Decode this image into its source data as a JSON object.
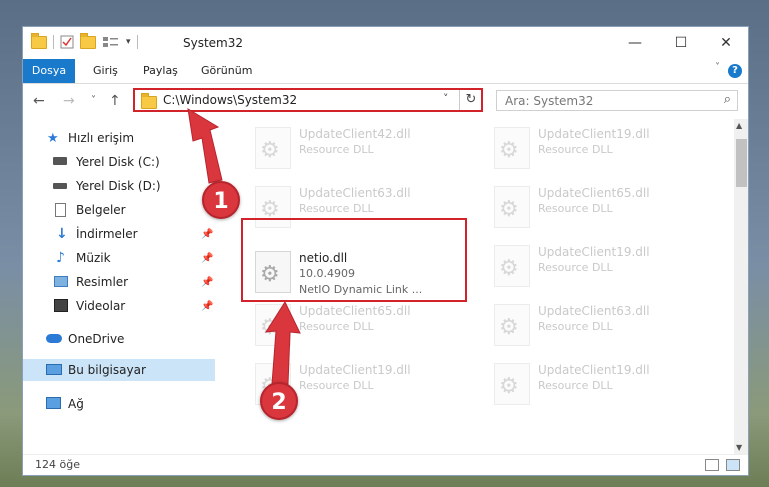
{
  "window": {
    "title": "System32",
    "minimize": "—",
    "maximize": "☐",
    "close": "✕"
  },
  "ribbon": {
    "tabs": [
      "Dosya",
      "Giriş",
      "Paylaş",
      "Görünüm"
    ],
    "help": "?"
  },
  "nav": {
    "back": "←",
    "forward": "→",
    "recent": "˅",
    "up": "↑"
  },
  "address": {
    "path": "C:\\Windows\\System32",
    "dropdown": "˅",
    "refresh": "↻"
  },
  "search": {
    "placeholder": "Ara: System32",
    "icon": "⌕"
  },
  "sidebar": {
    "items": [
      {
        "label": "Hızlı erişim",
        "icon": "star-icon"
      },
      {
        "label": "Yerel Disk (C:)",
        "icon": "drive-icon"
      },
      {
        "label": "Yerel Disk (D:)",
        "icon": "drive-icon"
      },
      {
        "label": "Belgeler",
        "icon": "documents-icon"
      },
      {
        "label": "İndirmeler",
        "icon": "download-icon"
      },
      {
        "label": "Müzik",
        "icon": "music-icon"
      },
      {
        "label": "Resimler",
        "icon": "pictures-icon"
      },
      {
        "label": "Videolar",
        "icon": "videos-icon"
      },
      {
        "label": "OneDrive",
        "icon": "cloud-icon"
      },
      {
        "label": "Bu bilgisayar",
        "icon": "computer-icon"
      },
      {
        "label": "Ağ",
        "icon": "network-icon"
      }
    ]
  },
  "files": {
    "col1": [
      {
        "name": "UpdateClient42.dll",
        "desc": "Resource DLL"
      },
      {
        "name": "UpdateClient63.dll",
        "desc": "Resource DLL"
      },
      {
        "name": "netio.dll",
        "version": "10.0.4909",
        "desc": "NetIO Dynamic Link ..."
      },
      {
        "name": "UpdateClient65.dll",
        "desc": "Resource DLL"
      },
      {
        "name": "UpdateClient19.dll",
        "desc": "Resource DLL"
      }
    ],
    "col2": [
      {
        "name": "UpdateClient19.dll",
        "desc": "Resource DLL"
      },
      {
        "name": "UpdateClient65.dll",
        "desc": "Resource DLL"
      },
      {
        "name": "UpdateClient19.dll",
        "desc": "Resource DLL"
      },
      {
        "name": "UpdateClient63.dll",
        "desc": "Resource DLL"
      },
      {
        "name": "UpdateClient19.dll",
        "desc": "Resource DLL"
      }
    ]
  },
  "status": {
    "count": "124 öğe"
  },
  "annotations": {
    "step1": "1",
    "step2": "2",
    "color": "#d3232a"
  }
}
